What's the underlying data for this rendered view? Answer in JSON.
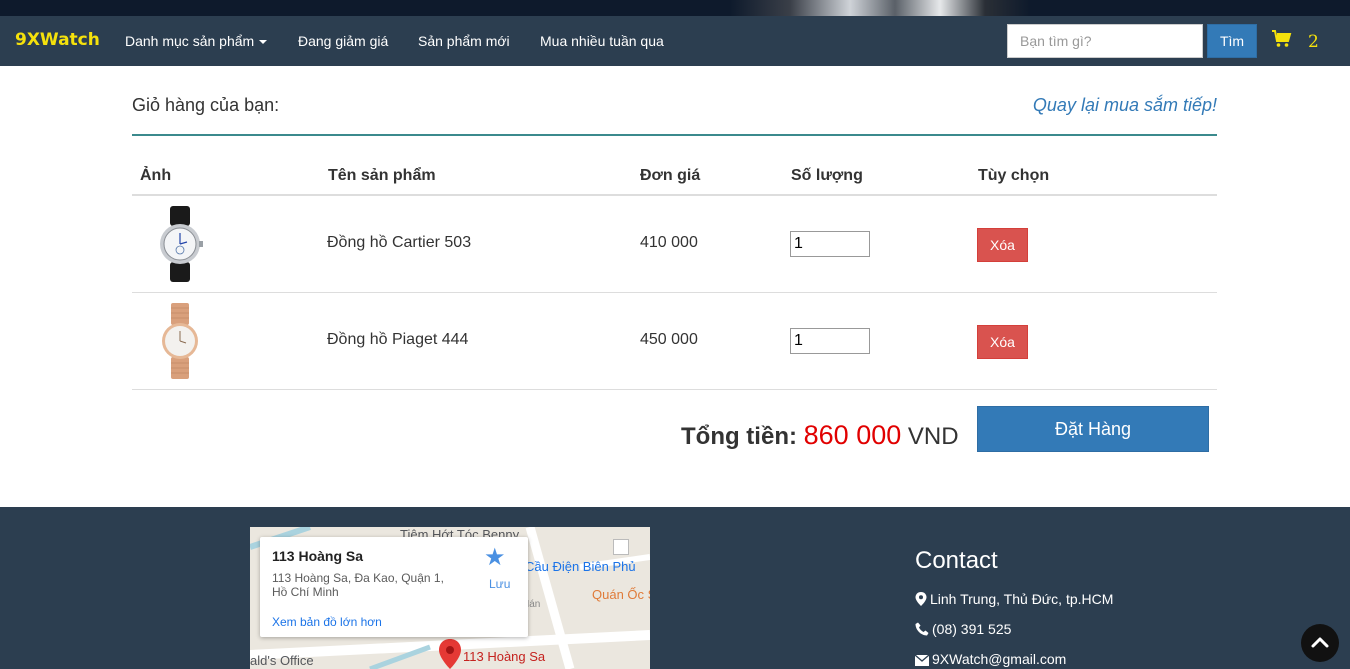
{
  "navbar": {
    "brand": "9XWatch",
    "items": [
      {
        "label": "Danh mục sản phẩm",
        "dropdown": true
      },
      {
        "label": "Đang giảm giá"
      },
      {
        "label": "Sản phẩm mới"
      },
      {
        "label": "Mua nhiều tuần qua"
      }
    ],
    "search": {
      "placeholder": "Bạn tìm gì?",
      "value": "",
      "button": "Tìm"
    },
    "cart_count": "2"
  },
  "cart": {
    "title": "Giỏ hàng của bạn:",
    "continue_link": "Quay lại mua sắm tiếp!",
    "columns": [
      "Ảnh",
      "Tên sản phẩm",
      "Đơn giá",
      "Số lượng",
      "Tùy chọn"
    ],
    "rows": [
      {
        "name": "Đồng hồ Cartier 503",
        "price": "410 000",
        "qty": "1",
        "action": "Xóa",
        "image": "watch-black-strap"
      },
      {
        "name": "Đồng hồ Piaget 444",
        "price": "450 000",
        "qty": "1",
        "action": "Xóa",
        "image": "watch-rose-gold"
      }
    ],
    "total_label": "Tổng tiền:",
    "total_amount": "860 000",
    "currency": "VND",
    "order_button": "Đặt Hàng"
  },
  "footer": {
    "map": {
      "place_title": "113 Hoàng Sa",
      "address": "113 Hoàng Sa, Đa Kao, Quận 1, Hồ Chí Minh",
      "larger_map_link": "Xem bản đồ lớn hơn",
      "save_label": "Lưu",
      "labels": [
        "Tiệm Hớt Tóc Benny",
        "Cầu Điện Biên Phủ",
        "Quán Ốc S",
        "ald's Office",
        "113 Hoàng Sa",
        "Hán"
      ]
    },
    "contact": {
      "title": "Contact",
      "address": "Linh Trung, Thủ Đức, tp.HCM",
      "phone": "(08) 391 525",
      "email": "9XWatch@gmail.com"
    }
  },
  "colors": {
    "navbar_bg": "#2c3e50",
    "brand": "#f5e10c",
    "primary": "#337ab7",
    "danger": "#d9534f",
    "total_amount": "#e10000",
    "divider": "#3b8a8d"
  }
}
